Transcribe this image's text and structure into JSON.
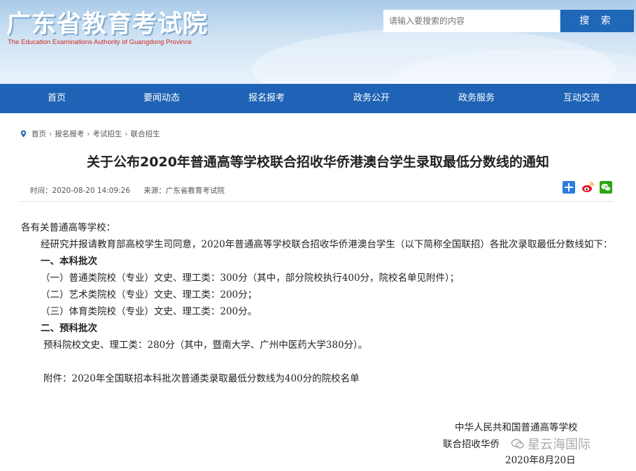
{
  "header": {
    "title": "广东省教育考试院",
    "subtitle": "The Education Examinations Authority of Guangdong Province",
    "search": {
      "placeholder": "请输入要搜索的内容",
      "button_label": "搜 索"
    }
  },
  "nav": {
    "items": [
      {
        "label": "首页"
      },
      {
        "label": "要闻动态"
      },
      {
        "label": "报名报考"
      },
      {
        "label": "政务公开"
      },
      {
        "label": "政务服务"
      },
      {
        "label": "互动交流"
      }
    ]
  },
  "breadcrumb": [
    "首页",
    "报名报考",
    "考试招生",
    "联合招生"
  ],
  "article": {
    "title": "关于公布2020年普通高等学校联合招收华侨港澳台学生录取最低分数线的通知",
    "time": "时间：2020-08-20 14:09:26",
    "source": "来源：广东省教育考试院",
    "paragraphs": [
      "各有关普通高等学校：",
      "经研究并报请教育部高校学生司同意，2020年普通高等学校联合招收华侨港澳台学生（以下简称全国联招）各批次录取最低分数线如下：",
      "一、本科批次",
      "（一）普通类院校（专业）文史、理工类：300分（其中，部分院校执行400分，院校名单见附件）；",
      "（二）艺术类院校（专业）文史、理工类：200分；",
      "（三）体育类院校（专业）文史、理工类：200分。",
      "二、预科批次",
      "预科院校文史、理工类：280分（其中，暨南大学、广州中医药大学380分）。",
      "附件：2020年全国联招本科批次普通类录取最低分数线为400分的院校名单"
    ],
    "signature": {
      "line1": "中华人民共和国普通高等学校",
      "line2": "联合招收华侨",
      "date": "2020年8月20日"
    }
  },
  "watermark": "星云海国际",
  "colors": {
    "nav": "#1e63b5",
    "search_button": "#1f67b7",
    "subtitle": "#d12a1f"
  }
}
